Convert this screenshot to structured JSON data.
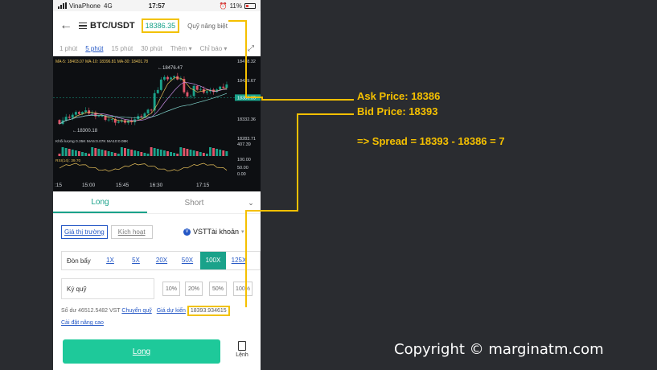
{
  "status": {
    "carrier": "VinaPhone",
    "network": "4G",
    "time": "17:57",
    "battery": "11%"
  },
  "header": {
    "pair": "BTC/USDT",
    "price": "18386.35",
    "fund_label": "Quỹ nâng biệt"
  },
  "timeframes": {
    "items": [
      "1 phút",
      "5 phút",
      "15 phút",
      "30 phút",
      "Thêm ▾",
      "Chỉ báo ▾"
    ],
    "active": "5 phút"
  },
  "chart_data": {
    "type": "candlestick",
    "ma_text": "MA-5: 18403.07  MA-10: 18396.81  MA-30: 18401.78",
    "price_ticks": [
      "18478.32",
      "18429.67",
      "18386.35",
      "18332.36",
      "18283.71"
    ],
    "high_label": "18476.47",
    "low_label": "18300.18",
    "volume_text": "Khối lượng 0.35K  MA5:0.07K  MA10:0.08K",
    "volume_ticks": [
      "407.39"
    ],
    "rsi_text": "RSI(14): 39.70",
    "rsi_ticks": [
      "100.00",
      "50.00",
      "0.00"
    ],
    "x_ticks": [
      ":15",
      "15:00",
      "15:45",
      "16:30",
      "17:15"
    ],
    "colors": {
      "up": "#1aa28a",
      "down": "#e0556a",
      "ma5": "#e8c15a",
      "ma10": "#c48be0",
      "ma30": "#7fd1c9"
    }
  },
  "tabs": {
    "long": "Long",
    "short": "Short",
    "chevron": "⌄"
  },
  "order_type": {
    "market": "Giá thị trường",
    "trigger": "Kích hoạt"
  },
  "account": {
    "label": "VSTTài khoản",
    "icon_text": "V"
  },
  "leverage": {
    "label": "Đòn bẩy",
    "options": [
      "1X",
      "5X",
      "20X",
      "50X",
      "100X",
      "125X"
    ],
    "selected": "100X"
  },
  "margin": {
    "label": "Ký quỹ",
    "percents": [
      "10%",
      "20%",
      "50%",
      "100%"
    ]
  },
  "balance": {
    "text": "Số dư 46512.5482 VST",
    "transfer": "Chuyển quỹ",
    "est_label": "Giá dự kiến",
    "est_price": "18393.934615"
  },
  "advanced": "Cài đặt nâng cao",
  "actions": {
    "long": "Long",
    "orders": "Lệnh"
  },
  "annotation": {
    "ask": "Ask Price: 18386",
    "bid": "Bid Price: 18393",
    "spread": "=> Spread = 18393  - 18386 = 7",
    "line_color": "#f5c000"
  },
  "copyright": "Copyright © marginatm.com"
}
